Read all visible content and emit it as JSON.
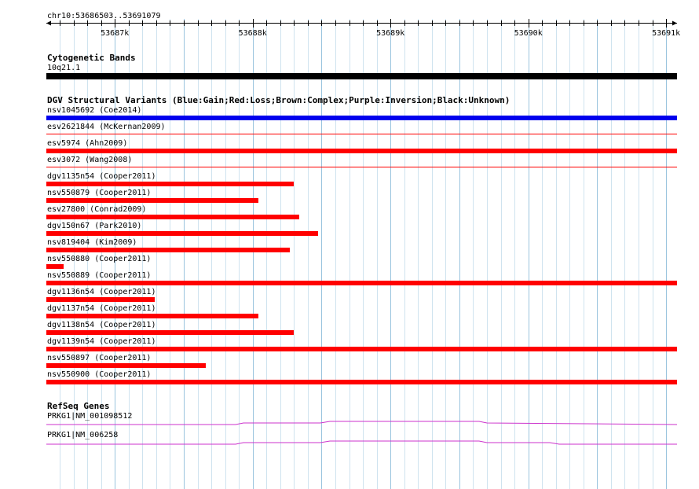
{
  "location": "chr10:53686503..53691079",
  "ruler": {
    "start": 53686503,
    "end": 53691079,
    "ticks": [
      {
        "pos": 53687000,
        "label": "53687k"
      },
      {
        "pos": 53688000,
        "label": "53688k"
      },
      {
        "pos": 53689000,
        "label": "53689k"
      },
      {
        "pos": 53690000,
        "label": "53690k"
      },
      {
        "pos": 53691000,
        "label": "53691k"
      }
    ]
  },
  "cytoband": {
    "title": "Cytogenetic Bands",
    "band_label": "10q21.1",
    "color": "#000000"
  },
  "dgv": {
    "title": "DGV Structural Variants (Blue:Gain;Red:Loss;Brown:Complex;Purple:Inversion;Black:Unknown)",
    "variants": [
      {
        "label": "nsv1045692 (Coe2014)",
        "start": 53686503,
        "end": 53691079,
        "color": "#0000ee",
        "style": "thick"
      },
      {
        "label": "esv2621844 (McKernan2009)",
        "start": 53686503,
        "end": 53691079,
        "color": "#ff0000",
        "style": "thin"
      },
      {
        "label": "esv5974 (Ahn2009)",
        "start": 53686503,
        "end": 53691079,
        "color": "#ff0000",
        "style": "thick"
      },
      {
        "label": "esv3072 (Wang2008)",
        "start": 53686503,
        "end": 53691079,
        "color": "#ff0000",
        "style": "thin"
      },
      {
        "label": "dgv1135n54 (Cooper2011)",
        "start": 53686503,
        "end": 53688300,
        "color": "#ff0000",
        "style": "thick"
      },
      {
        "label": "nsv550879 (Cooper2011)",
        "start": 53686503,
        "end": 53688040,
        "color": "#ff0000",
        "style": "thick"
      },
      {
        "label": "esv27800 (Conrad2009)",
        "start": 53686503,
        "end": 53688340,
        "color": "#ff0000",
        "style": "thick"
      },
      {
        "label": "dgv150n67 (Park2010)",
        "start": 53686503,
        "end": 53688475,
        "color": "#ff0000",
        "style": "thick"
      },
      {
        "label": "nsv819404 (Kim2009)",
        "start": 53686503,
        "end": 53688270,
        "color": "#ff0000",
        "style": "thick"
      },
      {
        "label": "nsv550880 (Cooper2011)",
        "start": 53686503,
        "end": 53686630,
        "color": "#ff0000",
        "style": "thick"
      },
      {
        "label": "nsv550889 (Cooper2011)",
        "start": 53686503,
        "end": 53691079,
        "color": "#ff0000",
        "style": "thick"
      },
      {
        "label": "dgv1136n54 (Cooper2011)",
        "start": 53686503,
        "end": 53687290,
        "color": "#ff0000",
        "style": "thick"
      },
      {
        "label": "dgv1137n54 (Cooper2011)",
        "start": 53686503,
        "end": 53688040,
        "color": "#ff0000",
        "style": "thick"
      },
      {
        "label": "dgv1138n54 (Cooper2011)",
        "start": 53686503,
        "end": 53688300,
        "color": "#ff0000",
        "style": "thick"
      },
      {
        "label": "dgv1139n54 (Cooper2011)",
        "start": 53686503,
        "end": 53691079,
        "color": "#ff0000",
        "style": "thick"
      },
      {
        "label": "nsv550897 (Cooper2011)",
        "start": 53686503,
        "end": 53687660,
        "color": "#ff0000",
        "style": "thick"
      },
      {
        "label": "nsv550900 (Cooper2011)",
        "start": 53686503,
        "end": 53691079,
        "color": "#ff0000",
        "style": "thick"
      }
    ]
  },
  "refseq": {
    "title": "RefSeq Genes",
    "color": "#cc33cc",
    "genes": [
      {
        "label": "PRKG1|NM_001098512"
      },
      {
        "label": "PRKG1|NM_006258"
      }
    ]
  }
}
